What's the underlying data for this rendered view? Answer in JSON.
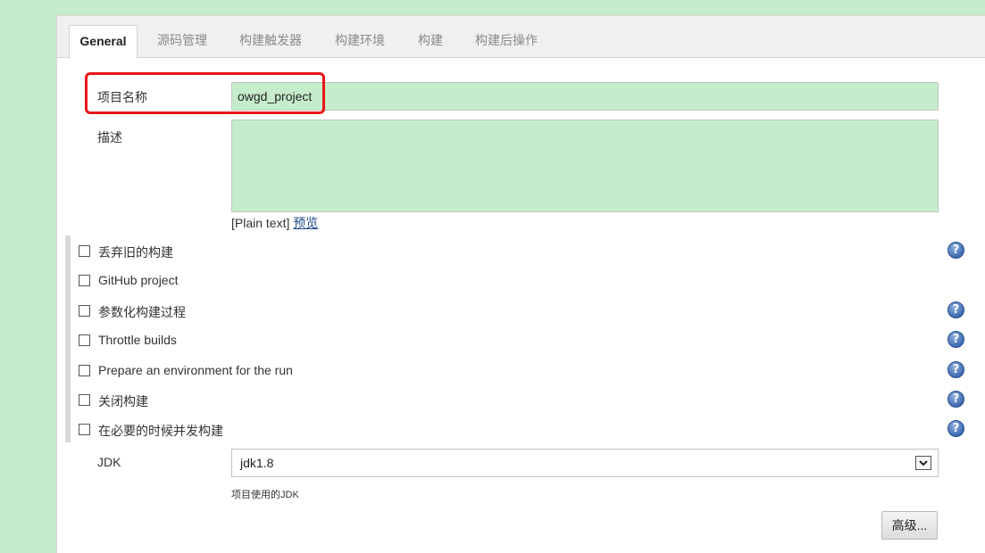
{
  "tabs": [
    {
      "label": "General"
    },
    {
      "label": "源码管理"
    },
    {
      "label": "构建触发器"
    },
    {
      "label": "构建环境"
    },
    {
      "label": "构建"
    },
    {
      "label": "构建后操作"
    }
  ],
  "project_name": {
    "label": "项目名称",
    "value": "owgd_project"
  },
  "description": {
    "label": "描述",
    "value": "",
    "format_text": "[Plain text]",
    "preview_link": "预览"
  },
  "options": [
    {
      "label": "丢弃旧的构建",
      "checked": false,
      "has_help": true
    },
    {
      "label": "GitHub project",
      "checked": false,
      "has_help": false
    },
    {
      "label": "参数化构建过程",
      "checked": false,
      "has_help": true
    },
    {
      "label": "Throttle builds",
      "checked": false,
      "has_help": true
    },
    {
      "label": "Prepare an environment for the run",
      "checked": false,
      "has_help": true
    },
    {
      "label": "关闭构建",
      "checked": false,
      "has_help": true
    },
    {
      "label": "在必要的时候并发构建",
      "checked": false,
      "has_help": true
    }
  ],
  "jdk": {
    "label": "JDK",
    "selected": "jdk1.8",
    "help_text": "项目使用的JDK"
  },
  "advanced_button": "高级...",
  "colors": {
    "page_bg": "#c6edcb",
    "highlight_box": "#e8151a",
    "help_icon": "#3e6ab1"
  }
}
